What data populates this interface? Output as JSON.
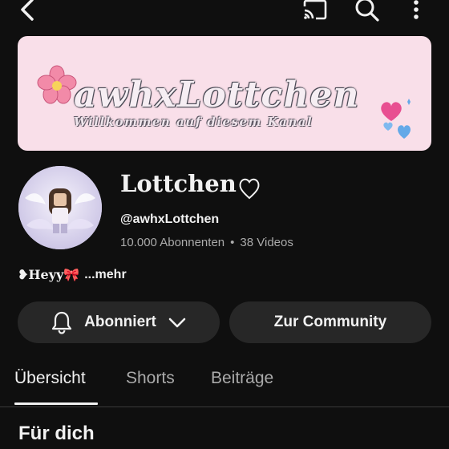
{
  "banner": {
    "title": "awhxLottchen",
    "subtitle": "Willkommen auf diesem Kanal",
    "background": "#f9dfe9"
  },
  "channel": {
    "name": "Lottchen",
    "handle": "@awhxLottchen",
    "subscribers": "10.000 Abonnenten",
    "separator": "•",
    "videos": "38 Videos"
  },
  "description": {
    "text": "❥Heyy🎀",
    "more": "...mehr"
  },
  "buttons": {
    "subscribe_label": "Abonniert",
    "community_label": "Zur Community"
  },
  "tabs": [
    {
      "label": "Übersicht",
      "active": true
    },
    {
      "label": "Shorts",
      "active": false
    },
    {
      "label": "Beiträge",
      "active": false
    }
  ],
  "section": {
    "title": "Für dich"
  },
  "icons": {
    "back": "chevron-left-icon",
    "cast": "cast-icon",
    "search": "search-icon",
    "more": "more-vertical-icon",
    "bell": "bell-icon",
    "dropdown": "chevron-down-icon"
  },
  "colors": {
    "background": "#0f0f0f",
    "pill": "#272727",
    "text": "#f1f1f1",
    "muted": "#aaaaaa"
  }
}
